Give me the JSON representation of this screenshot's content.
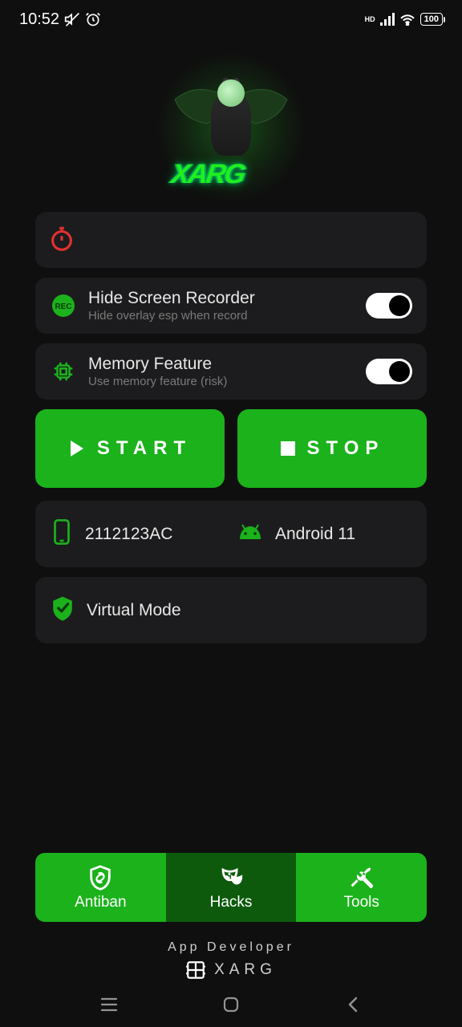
{
  "status": {
    "time": "10:52",
    "battery": "100"
  },
  "timer": {},
  "toggles": {
    "recorder": {
      "title": "Hide Screen Recorder",
      "subtitle": "Hide overlay esp when record",
      "enabled": true
    },
    "memory": {
      "title": "Memory Feature",
      "subtitle": "Use memory feature (risk)",
      "enabled": true
    }
  },
  "actions": {
    "start": "START",
    "stop": "STOP"
  },
  "device": {
    "model": "2112123AC",
    "os": "Android 11"
  },
  "mode": {
    "label": "Virtual Mode"
  },
  "nav": {
    "antiban": "Antiban",
    "hacks": "Hacks",
    "tools": "Tools"
  },
  "footer": {
    "label": "App Developer",
    "brand": "XARG"
  },
  "logo": {
    "brand": "XARG"
  }
}
